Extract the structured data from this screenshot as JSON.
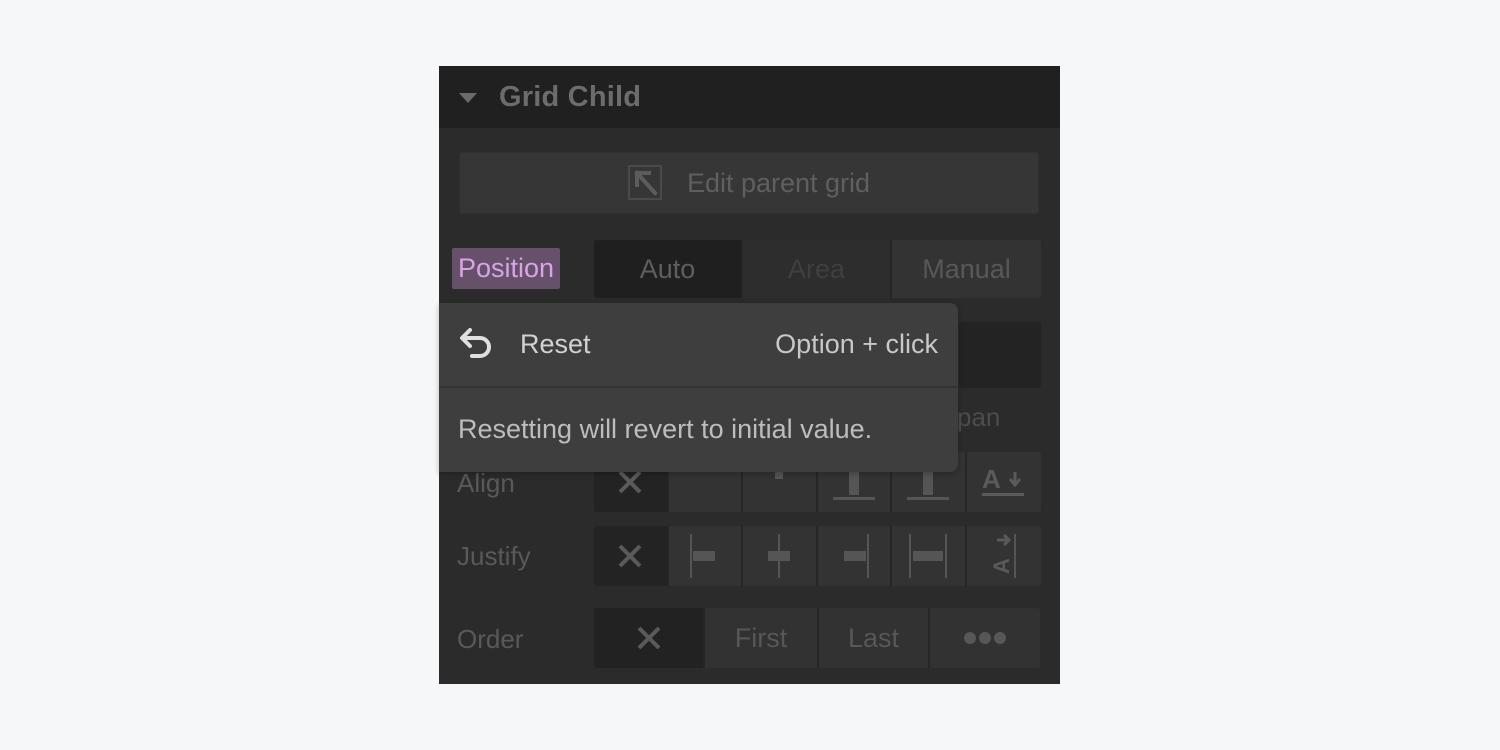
{
  "panel": {
    "title": "Grid Child",
    "edit_parent_label": "Edit parent grid"
  },
  "position": {
    "label": "Position",
    "options": [
      "Auto",
      "Area",
      "Manual"
    ],
    "selected": "Auto"
  },
  "span_fragment": "pan",
  "align": {
    "label": "Align",
    "icons": [
      "none-x-icon",
      "align-start-icon",
      "align-center-icon",
      "align-end-icon",
      "align-stretch-icon",
      "align-baseline-icon"
    ]
  },
  "justify": {
    "label": "Justify",
    "icons": [
      "none-x-icon",
      "justify-start-icon",
      "justify-center-icon",
      "justify-end-icon",
      "justify-stretch-icon",
      "justify-baseline-icon"
    ]
  },
  "order": {
    "label": "Order",
    "options": [
      "✕",
      "First",
      "Last",
      "•••"
    ]
  },
  "popover": {
    "action_label": "Reset",
    "shortcut": "Option + click",
    "description": "Resetting will revert to initial value."
  },
  "colors": {
    "position_highlight_bg": "#66506a",
    "position_highlight_text": "#d8a4e6"
  }
}
